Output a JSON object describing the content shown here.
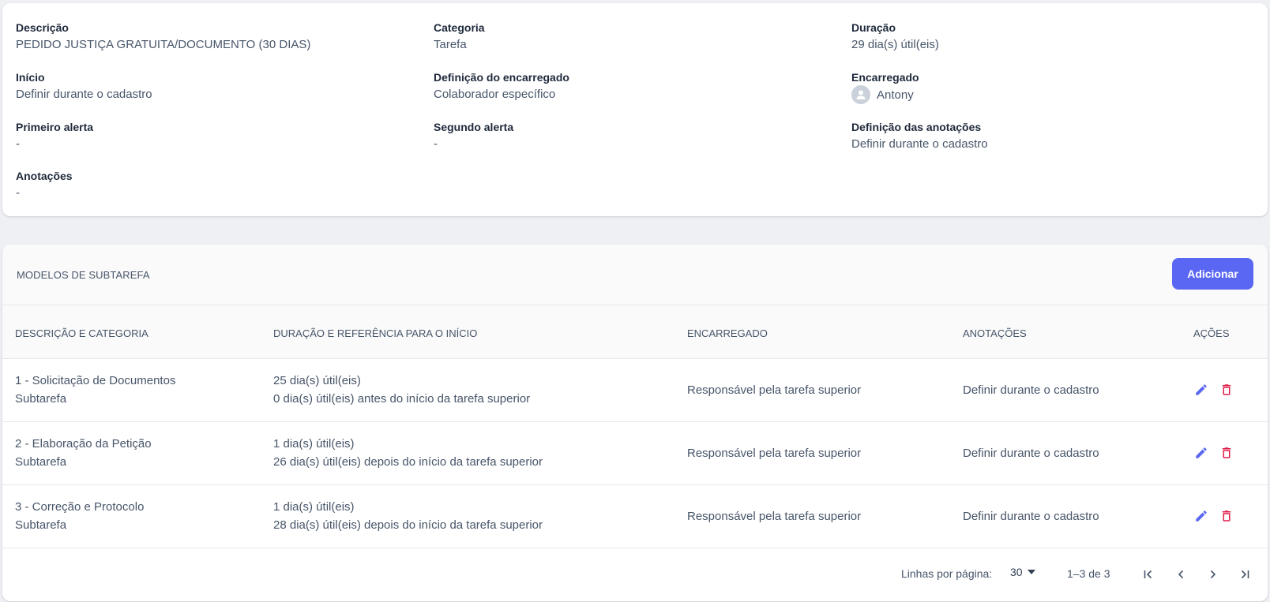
{
  "details": {
    "descricao": {
      "label": "Descrição",
      "value": "PEDIDO JUSTIÇA GRATUITA/DOCUMENTO (30 DIAS)"
    },
    "categoria": {
      "label": "Categoria",
      "value": "Tarefa"
    },
    "duracao": {
      "label": "Duração",
      "value": "29 dia(s) útil(eis)"
    },
    "inicio": {
      "label": "Início",
      "value": "Definir durante o cadastro"
    },
    "definicao_encarregado": {
      "label": "Definição do encarregado",
      "value": "Colaborador específico"
    },
    "encarregado": {
      "label": "Encarregado",
      "value": "Antony",
      "icon": "user-avatar-icon"
    },
    "primeiro_alerta": {
      "label": "Primeiro alerta",
      "value": "-"
    },
    "segundo_alerta": {
      "label": "Segundo alerta",
      "value": "-"
    },
    "definicao_anotacoes": {
      "label": "Definição das anotações",
      "value": "Definir durante o cadastro"
    },
    "anotacoes": {
      "label": "Anotações",
      "value": "-"
    }
  },
  "subtasks": {
    "title": "MODELOS DE SUBTAREFA",
    "add_label": "Adicionar",
    "columns": [
      "DESCRIÇÃO E CATEGORIA",
      "DURAÇÃO E REFERÊNCIA PARA O INÍCIO",
      "ENCARREGADO",
      "ANOTAÇÕES",
      "AÇÕES"
    ],
    "rows": [
      {
        "descricao": "1 - Solicitação de Documentos",
        "categoria": "Subtarefa",
        "duracao": "25 dia(s) útil(eis)",
        "referencia": "0 dia(s) útil(eis) antes do início da tarefa superior",
        "encarregado": "Responsável pela tarefa superior",
        "anotacoes": "Definir durante o cadastro"
      },
      {
        "descricao": "2 - Elaboração da Petição",
        "categoria": "Subtarefa",
        "duracao": "1 dia(s) útil(eis)",
        "referencia": "26 dia(s) útil(eis) depois do início da tarefa superior",
        "encarregado": "Responsável pela tarefa superior",
        "anotacoes": "Definir durante o cadastro"
      },
      {
        "descricao": "3 - Correção e Protocolo",
        "categoria": "Subtarefa",
        "duracao": "1 dia(s) útil(eis)",
        "referencia": "28 dia(s) útil(eis) depois do início da tarefa superior",
        "encarregado": "Responsável pela tarefa superior",
        "anotacoes": "Definir durante o cadastro"
      }
    ],
    "actions": {
      "edit_icon": "pencil-icon",
      "delete_icon": "trash-icon"
    }
  },
  "pagination": {
    "rows_per_page_label": "Linhas por página:",
    "rows_per_page_value": "30",
    "range_text": "1–3 de 3",
    "icons": [
      "first-page-icon",
      "previous-page-icon",
      "next-page-icon",
      "last-page-icon"
    ]
  },
  "colors": {
    "accent": "#5a67f2",
    "edit_icon": "#5a67f2",
    "delete_icon": "#e11d48",
    "background": "#eef0f4"
  }
}
